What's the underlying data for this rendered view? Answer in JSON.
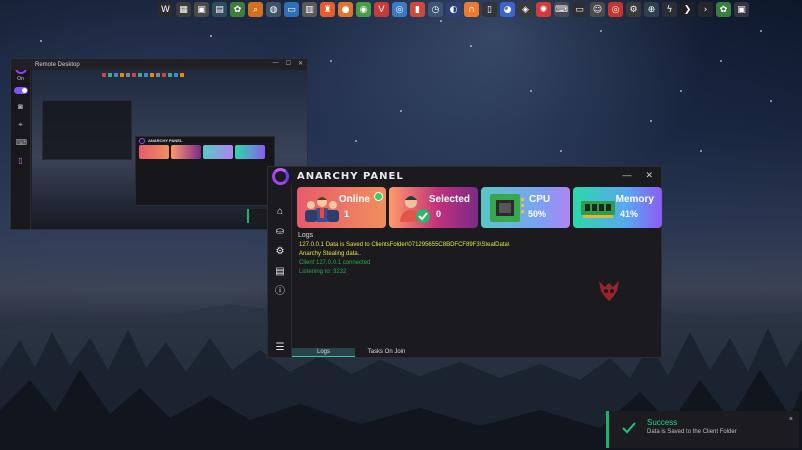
{
  "taskbar": {
    "icons": [
      {
        "name": "wallpaper-engine-icon",
        "color": "#2a2a2a",
        "glyph": "W"
      },
      {
        "name": "paint-icon",
        "color": "#3b3b3b",
        "glyph": "▦"
      },
      {
        "name": "media-player-icon",
        "color": "#4a4a4a",
        "glyph": "▣"
      },
      {
        "name": "calendar-icon",
        "color": "#2f4b5e",
        "glyph": "▤"
      },
      {
        "name": "settings-gear-icon",
        "color": "#3e7d3e",
        "glyph": "✿"
      },
      {
        "name": "search-icon",
        "color": "#d46f1e",
        "glyph": "⌕"
      },
      {
        "name": "globe-icon",
        "color": "#3f5468",
        "glyph": "◍"
      },
      {
        "name": "files-icon",
        "color": "#2f6fb7",
        "glyph": "▭"
      },
      {
        "name": "calculator-icon",
        "color": "#5a5a5a",
        "glyph": "▥"
      },
      {
        "name": "brave-icon",
        "color": "#e45d2b",
        "glyph": "♜"
      },
      {
        "name": "firefox-icon",
        "color": "#e2742d",
        "glyph": "●"
      },
      {
        "name": "chrome-icon",
        "color": "#4c9b45",
        "glyph": "◉"
      },
      {
        "name": "vivaldi-icon",
        "color": "#c93b3b",
        "glyph": "V"
      },
      {
        "name": "chromium-icon",
        "color": "#3b79c4",
        "glyph": "◎"
      },
      {
        "name": "notes-icon",
        "color": "#d0473d",
        "glyph": "▮"
      },
      {
        "name": "timer-icon",
        "color": "#3c5570",
        "glyph": "◷"
      },
      {
        "name": "steam-icon",
        "color": "#2c3f78",
        "glyph": "◐"
      },
      {
        "name": "arc-icon",
        "color": "#ef7a2f",
        "glyph": "∩"
      },
      {
        "name": "terminal-icon",
        "color": "#33333b",
        "glyph": "▯"
      },
      {
        "name": "colors-icon",
        "color": "#3d63d1",
        "glyph": "◕"
      },
      {
        "name": "camera-icon",
        "color": "#3a3a3a",
        "glyph": "◈"
      },
      {
        "name": "pinwheel-icon",
        "color": "#d23b3b",
        "glyph": "✺"
      },
      {
        "name": "keyboard-icon",
        "color": "#4a4a52",
        "glyph": "⌨"
      },
      {
        "name": "monitor-icon",
        "color": "#2d2d34",
        "glyph": "▭"
      },
      {
        "name": "bot-icon",
        "color": "#4a4a4a",
        "glyph": "☺"
      },
      {
        "name": "lifebuoy-icon",
        "color": "#c5342f",
        "glyph": "◎"
      },
      {
        "name": "settings-icon",
        "color": "#3a3a3a",
        "glyph": "⚙"
      },
      {
        "name": "network-icon",
        "color": "#2d3e52",
        "glyph": "⊕"
      },
      {
        "name": "lightning-icon",
        "color": "#2d2d34",
        "glyph": "ϟ"
      },
      {
        "name": "code-icon",
        "color": "#1f1f26",
        "glyph": "❯"
      },
      {
        "name": "terminal-prompt-icon",
        "color": "#26262d",
        "glyph": "›"
      },
      {
        "name": "gear-icon",
        "color": "#3a7d3e",
        "glyph": "✿"
      },
      {
        "name": "display-icon",
        "color": "#353540",
        "glyph": "▣"
      }
    ]
  },
  "remote_desktop": {
    "title": "Remote Desktop",
    "side_toggle_label": "On",
    "mini_panel_title": "ANARCHY PANEL"
  },
  "panel": {
    "title": "ANARCHY PANEL",
    "accent": "#a045f0",
    "cards": {
      "online": {
        "label": "Online",
        "value": "1"
      },
      "selected": {
        "label": "Selected",
        "value": "0"
      },
      "cpu": {
        "label": "CPU",
        "value": "50%"
      },
      "memory": {
        "label": "Memory",
        "value": "41%"
      }
    },
    "logs_title": "Logs",
    "logs": [
      {
        "text": "127.0.0.1 Data is Saved to ClientsFolder\\071295655C8BDFCF89F3\\StealData\\",
        "color": "#e6e04a"
      },
      {
        "text": "Anarchy Stealing data..",
        "color": "#e6e04a"
      },
      {
        "text": "Client 127.0.0.1 connected",
        "color": "#2ea84a"
      },
      {
        "text": "Listening to: 3232",
        "color": "#2ea84a"
      }
    ],
    "tabs": [
      {
        "label": "Logs",
        "active": true
      },
      {
        "label": "Tasks On Join",
        "active": false
      }
    ]
  },
  "toast": {
    "title": "Success",
    "message": "Data is Saved to the Client Folder",
    "close": "×"
  }
}
